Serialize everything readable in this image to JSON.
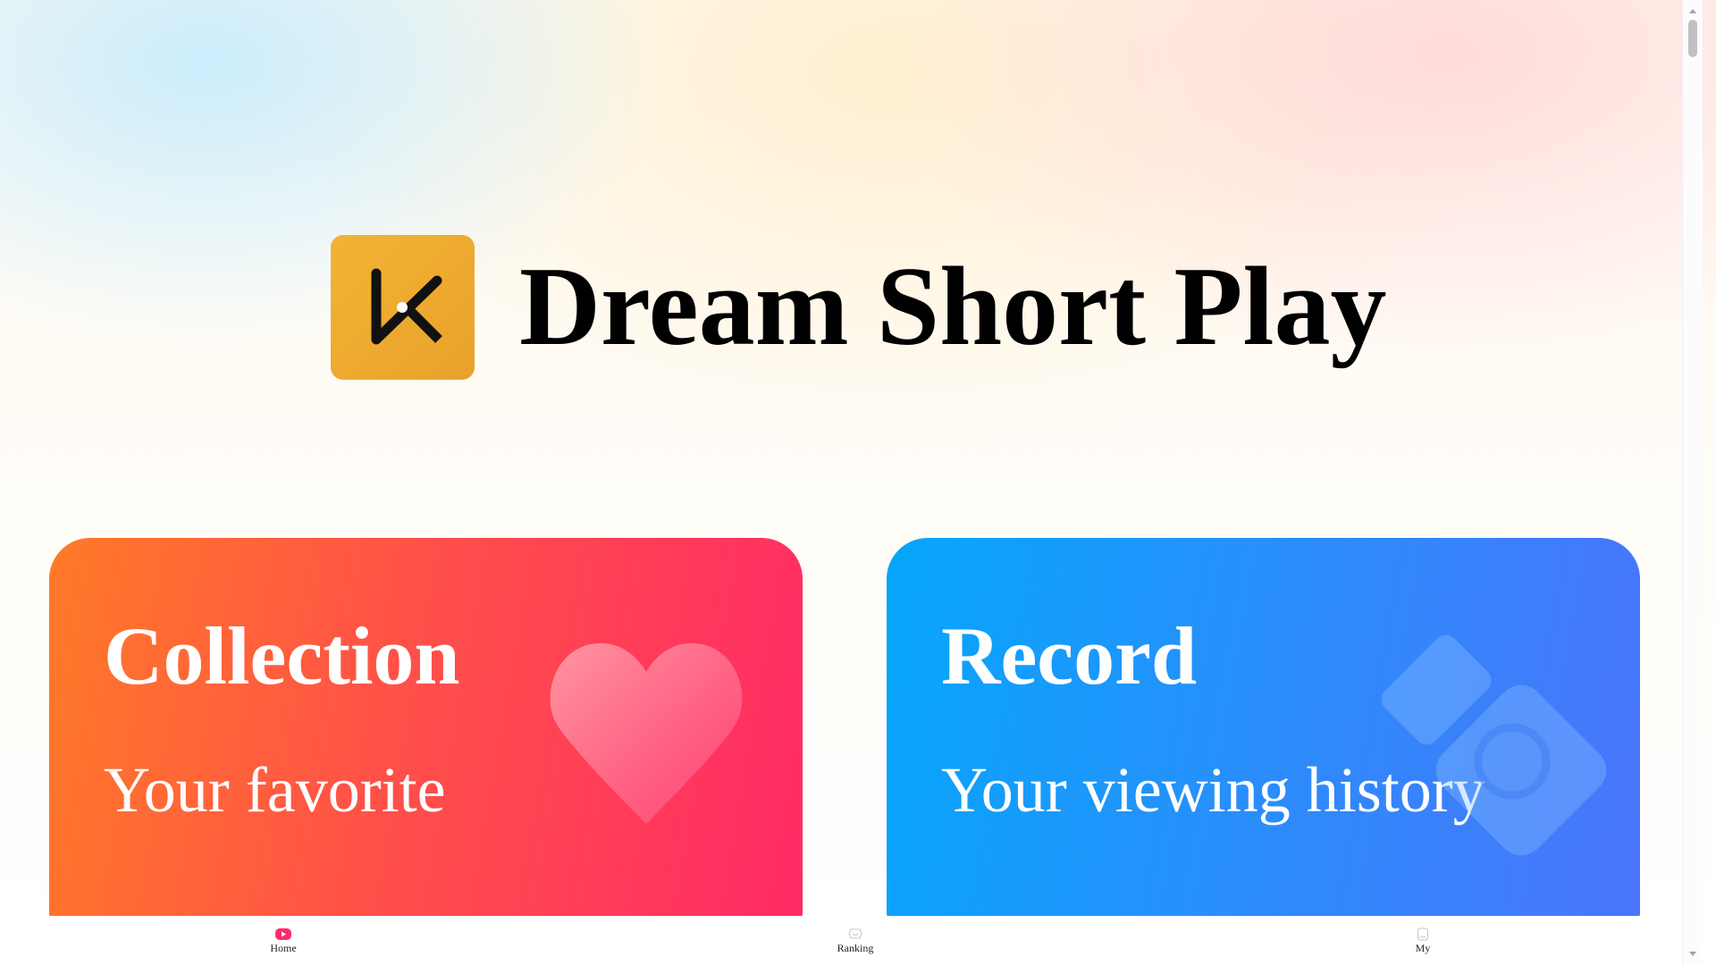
{
  "app": {
    "title": "Dream Short Play",
    "logo_icon": "scissors-play-logo-icon",
    "logo_color": "#EDAA30"
  },
  "cards": {
    "collection": {
      "title": "Collection",
      "subtitle": "Your favorite",
      "icon": "heart-icon",
      "gradient": [
        "#FF7A28",
        "#FF2A66"
      ]
    },
    "record": {
      "title": "Record",
      "subtitle": "Your viewing history",
      "icon": "film-history-icon",
      "gradient": [
        "#06A7FB",
        "#4A74FB"
      ]
    }
  },
  "tabbar": {
    "items": [
      {
        "label": "Home",
        "icon": "play-icon",
        "active": true,
        "active_color": "#FF2D6A"
      },
      {
        "label": "Ranking",
        "icon": "ranking-icon",
        "active": false
      },
      {
        "label": "My",
        "icon": "user-icon",
        "active": false
      }
    ]
  }
}
